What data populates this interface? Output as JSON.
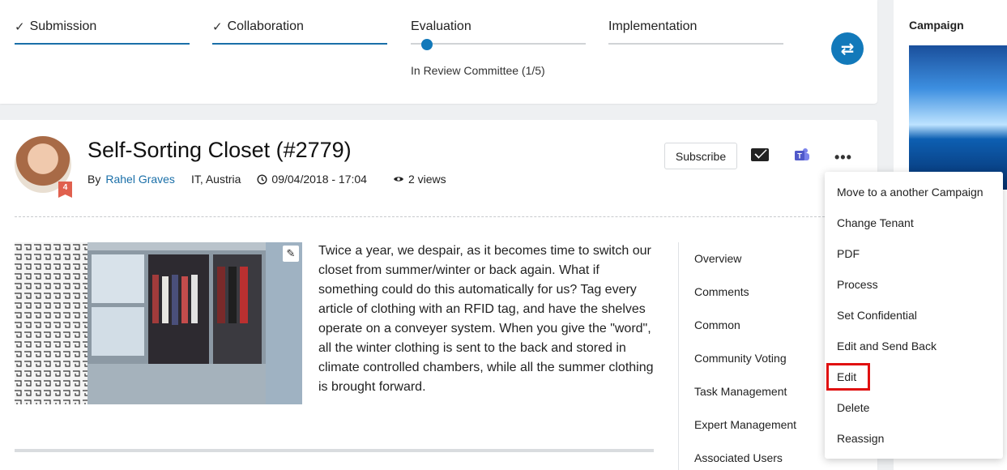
{
  "stages": [
    {
      "label": "Submission",
      "done": true
    },
    {
      "label": "Collaboration",
      "done": true
    },
    {
      "label": "Evaluation",
      "done": false,
      "current": true
    },
    {
      "label": "Implementation",
      "done": false
    }
  ],
  "stage_status": "In Review Committee (1/5)",
  "idea": {
    "title": "Self-Sorting Closet (#2779)",
    "by_label": "By",
    "author": "Rahel Graves",
    "location": "IT, Austria",
    "date": "09/04/2018 - 17:04",
    "views": "2 views",
    "badge_count": "4",
    "description": "Twice a year, we despair, as it becomes time to switch our closet from summer/winter or back again. What if something could do this automatically for us? Tag every article of clothing with an RFID tag, and have the shelves operate on a conveyer system. When you give the \"word\", all the winter clothing is sent to the back and stored in climate controlled chambers, while all the summer clothing is brought forward."
  },
  "header_actions": {
    "subscribe_label": "Subscribe",
    "more_label": "•••"
  },
  "side_nav": [
    "Overview",
    "Comments",
    "Common",
    "Community Voting",
    "Task Management",
    "Expert Management",
    "Associated Users"
  ],
  "right_panel": {
    "campaign_label": "Campaign"
  },
  "menu": {
    "items": [
      "Move to a another Campaign",
      "Change Tenant",
      "PDF",
      "Process",
      "Set Confidential",
      "Edit and Send Back",
      "Edit",
      "Delete",
      "Reassign"
    ],
    "highlighted": "Edit"
  },
  "colors": {
    "accent": "#1279ba",
    "highlight_box": "#e01010"
  }
}
